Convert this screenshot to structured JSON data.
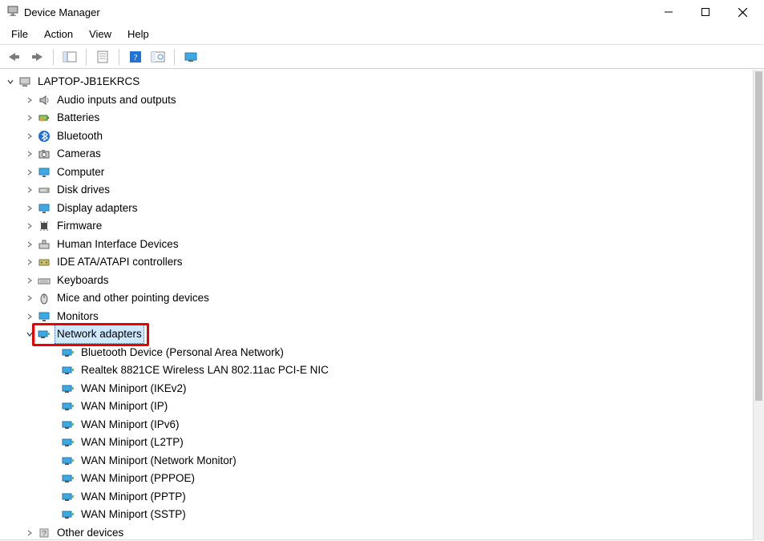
{
  "window": {
    "title": "Device Manager"
  },
  "menu": {
    "file": "File",
    "action": "Action",
    "view": "View",
    "help": "Help"
  },
  "root": {
    "label": "LAPTOP-JB1EKRCS"
  },
  "categories": [
    {
      "label": "Audio inputs and outputs",
      "icon": "speaker"
    },
    {
      "label": "Batteries",
      "icon": "battery"
    },
    {
      "label": "Bluetooth",
      "icon": "bluetooth"
    },
    {
      "label": "Cameras",
      "icon": "camera"
    },
    {
      "label": "Computer",
      "icon": "monitor"
    },
    {
      "label": "Disk drives",
      "icon": "disk"
    },
    {
      "label": "Display adapters",
      "icon": "monitor"
    },
    {
      "label": "Firmware",
      "icon": "chip"
    },
    {
      "label": "Human Interface Devices",
      "icon": "hid"
    },
    {
      "label": "IDE ATA/ATAPI controllers",
      "icon": "ide"
    },
    {
      "label": "Keyboards",
      "icon": "keyboard"
    },
    {
      "label": "Mice and other pointing devices",
      "icon": "mouse"
    },
    {
      "label": "Monitors",
      "icon": "monitor"
    }
  ],
  "network": {
    "label": "Network adapters",
    "children": [
      "Bluetooth Device (Personal Area Network)",
      "Realtek 8821CE Wireless LAN 802.11ac PCI-E NIC",
      "WAN Miniport (IKEv2)",
      "WAN Miniport (IP)",
      "WAN Miniport (IPv6)",
      "WAN Miniport (L2TP)",
      "WAN Miniport (Network Monitor)",
      "WAN Miniport (PPPOE)",
      "WAN Miniport (PPTP)",
      "WAN Miniport (SSTP)"
    ]
  },
  "trailing": {
    "label": "Other devices"
  }
}
